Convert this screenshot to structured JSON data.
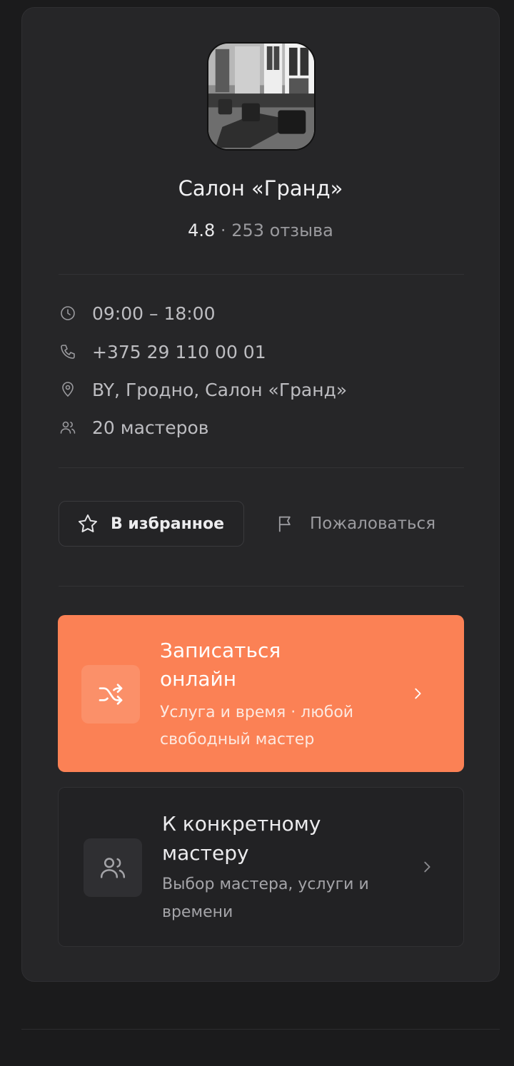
{
  "salon": {
    "name": "Салон «Гранд»",
    "rating": "4.8",
    "separator": "·",
    "reviews": "253 отзыва"
  },
  "info": {
    "hours": "09:00 – 18:00",
    "phone": "+375 29 110 00 01",
    "address": "BY, Гродно, Салон «Гранд»",
    "masters": "20 мастеров"
  },
  "actions": {
    "favorite_label": "В избранное",
    "report_label": "Пожаловаться"
  },
  "booking": {
    "online_title": "Записаться онлайн",
    "online_subtitle": "Услуга и время · любой свободный мастер",
    "master_title": "К конкретному мастеру",
    "master_subtitle": "Выбор мастера, услуги и времени"
  },
  "colors": {
    "accent": "#fb8155",
    "background": "#1b1b1c",
    "card": "#262628"
  },
  "icons": {
    "hours": "clock-icon",
    "phone": "phone-icon",
    "address": "location-pin-icon",
    "masters": "users-icon",
    "favorite": "star-icon",
    "report": "flag-icon",
    "online": "shuffle-icon",
    "master": "users-icon",
    "chevron": "chevron-right-icon"
  }
}
